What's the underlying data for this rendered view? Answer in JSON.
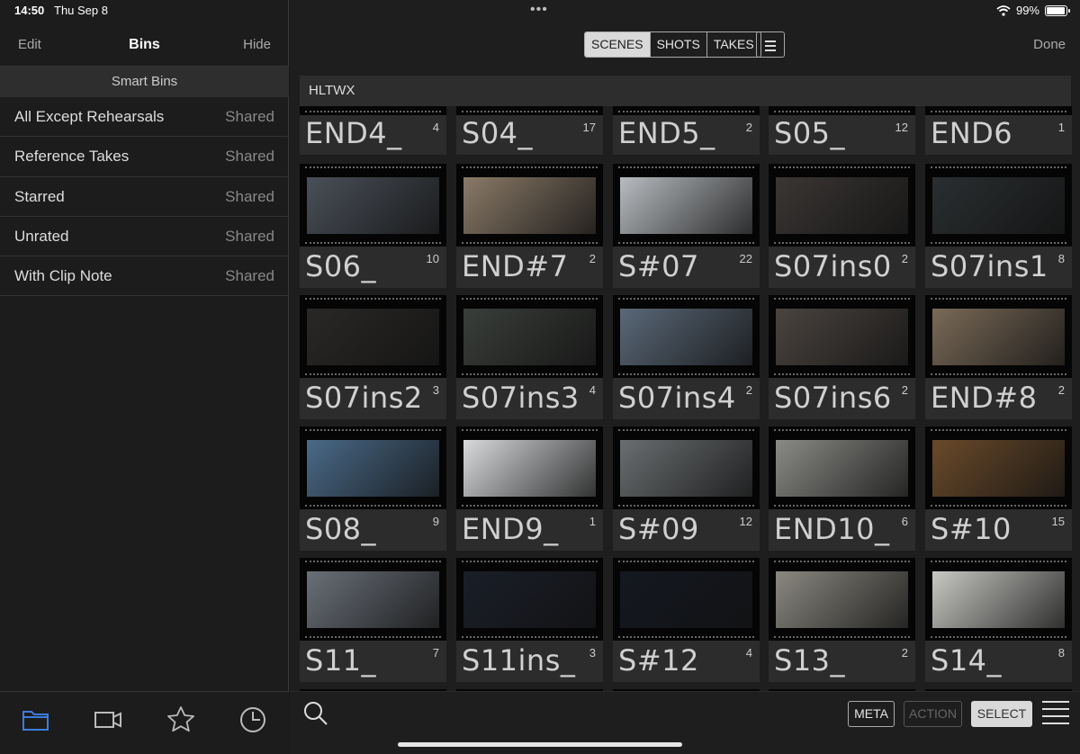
{
  "status": {
    "time": "14:50",
    "date": "Thu Sep 8",
    "battery": "99%",
    "dots": "•••"
  },
  "sidebar": {
    "edit": "Edit",
    "title": "Bins",
    "hide": "Hide",
    "section": "Smart Bins",
    "items": [
      {
        "label": "All Except Rehearsals",
        "tag": "Shared"
      },
      {
        "label": "Reference Takes",
        "tag": "Shared"
      },
      {
        "label": "Starred",
        "tag": "Shared"
      },
      {
        "label": "Unrated",
        "tag": "Shared"
      },
      {
        "label": "With Clip Note",
        "tag": "Shared"
      }
    ],
    "tabs": [
      "folder-icon",
      "camera-icon",
      "star-icon",
      "clock-icon"
    ],
    "active_tab_color": "#3b7ddd"
  },
  "header": {
    "segments": [
      "SCENES",
      "SHOTS",
      "TAKES"
    ],
    "active_segment": "SCENES",
    "done": "Done"
  },
  "bin": {
    "name": "HLTWX"
  },
  "rows": [
    [
      {
        "name": "END4_",
        "count": "4"
      },
      {
        "name": "S04_",
        "count": "17"
      },
      {
        "name": "END5_",
        "count": "2"
      },
      {
        "name": "S05_",
        "count": "12"
      },
      {
        "name": "END6",
        "count": "1"
      }
    ],
    [
      {
        "name": "S06_",
        "count": "10"
      },
      {
        "name": "END#7",
        "count": "2"
      },
      {
        "name": "S#07",
        "count": "22"
      },
      {
        "name": "S07ins0",
        "count": "2"
      },
      {
        "name": "S07ins1",
        "count": "8"
      }
    ],
    [
      {
        "name": "S07ins2",
        "count": "3"
      },
      {
        "name": "S07ins3",
        "count": "4"
      },
      {
        "name": "S07ins4",
        "count": "2"
      },
      {
        "name": "S07ins6",
        "count": "2"
      },
      {
        "name": "END#8",
        "count": "2"
      }
    ],
    [
      {
        "name": "S08_",
        "count": "9"
      },
      {
        "name": "END9_",
        "count": "1"
      },
      {
        "name": "S#09",
        "count": "12"
      },
      {
        "name": "END10_",
        "count": "6"
      },
      {
        "name": "S#10",
        "count": "15"
      }
    ],
    [
      {
        "name": "S11_",
        "count": "7"
      },
      {
        "name": "S11ins_",
        "count": "3"
      },
      {
        "name": "S#12",
        "count": "4"
      },
      {
        "name": "S13_",
        "count": "2"
      },
      {
        "name": "S14_",
        "count": "8"
      }
    ]
  ],
  "thumb_colors": [
    [
      "#2a2a2a",
      "#2a2a2a",
      "#2a2a2a",
      "#2a2a2a",
      "#2a2a2a"
    ],
    [
      "#4a5058",
      "#8a7a68",
      "#b8bcc0",
      "#3a3634",
      "#2a2e30"
    ],
    [
      "#2a2826",
      "#3a3e3a",
      "#5a6878",
      "#4a4440",
      "#7a6a58"
    ],
    [
      "#4a6a88",
      "#d8dadc",
      "#6a6e70",
      "#8a8a86",
      "#6a4a2a"
    ],
    [
      "#6a7078",
      "#1a1e28",
      "#141820",
      "#8a8880",
      "#c8c8c4"
    ]
  ],
  "toolbar": {
    "meta": "META",
    "action": "ACTION",
    "select": "SELECT"
  }
}
